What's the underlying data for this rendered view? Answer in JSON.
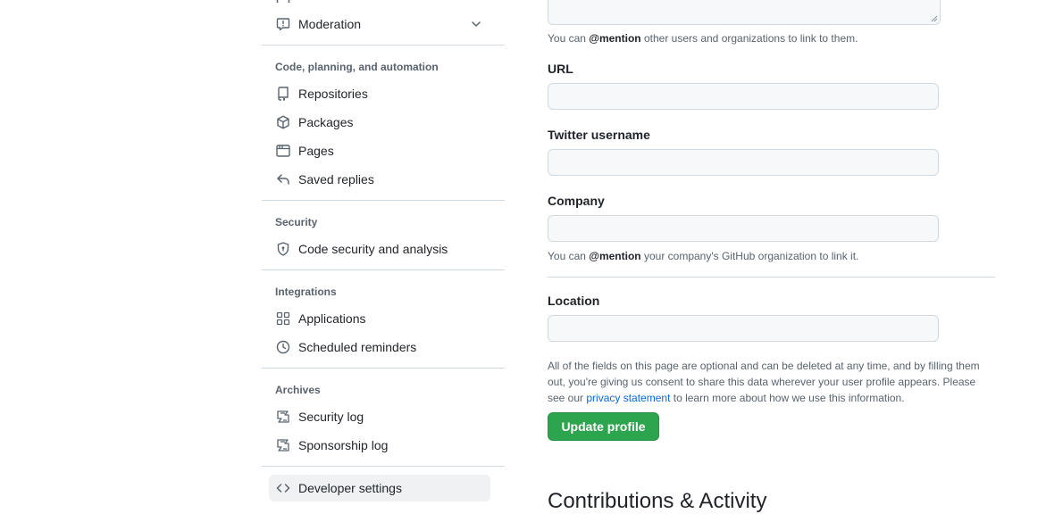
{
  "sidebar": {
    "moderation": {
      "label": "Moderation",
      "icon": "report-icon"
    },
    "groups": [
      {
        "title": "Code, planning, and automation",
        "items": [
          {
            "label": "Repositories",
            "icon": "repo-icon"
          },
          {
            "label": "Packages",
            "icon": "package-icon"
          },
          {
            "label": "Pages",
            "icon": "browser-icon"
          },
          {
            "label": "Saved replies",
            "icon": "reply-icon"
          }
        ]
      },
      {
        "title": "Security",
        "items": [
          {
            "label": "Code security and analysis",
            "icon": "shield-lock-icon"
          }
        ]
      },
      {
        "title": "Integrations",
        "items": [
          {
            "label": "Applications",
            "icon": "apps-icon"
          },
          {
            "label": "Scheduled reminders",
            "icon": "clock-icon"
          }
        ]
      },
      {
        "title": "Archives",
        "items": [
          {
            "label": "Security log",
            "icon": "log-icon"
          },
          {
            "label": "Sponsorship log",
            "icon": "log-icon"
          }
        ]
      }
    ],
    "developer_settings": {
      "label": "Developer settings",
      "icon": "code-icon"
    }
  },
  "profile_form": {
    "bio_note": {
      "prefix": "You can ",
      "mention": "@mention",
      "suffix": " other users and organizations to link to them."
    },
    "url": {
      "label": "URL",
      "value": ""
    },
    "twitter": {
      "label": "Twitter username",
      "value": ""
    },
    "company": {
      "label": "Company",
      "value": ""
    },
    "company_note": {
      "prefix": "You can ",
      "mention": "@mention",
      "suffix": " your company's GitHub organization to link it."
    },
    "location": {
      "label": "Location",
      "value": ""
    },
    "disclaimer": {
      "before": "All of the fields on this page are optional and can be deleted at any time, and by filling them out, you're giving us consent to share this data wherever your user profile appears. Please see our ",
      "link": "privacy statement",
      "after": " to learn more about how we use this information."
    },
    "submit_label": "Update profile"
  },
  "contributions": {
    "heading": "Contributions & Activity"
  },
  "colors": {
    "primary_button": "#2da44e",
    "link": "#0969da",
    "muted_text": "#59636e",
    "border": "#d1d9e0"
  }
}
